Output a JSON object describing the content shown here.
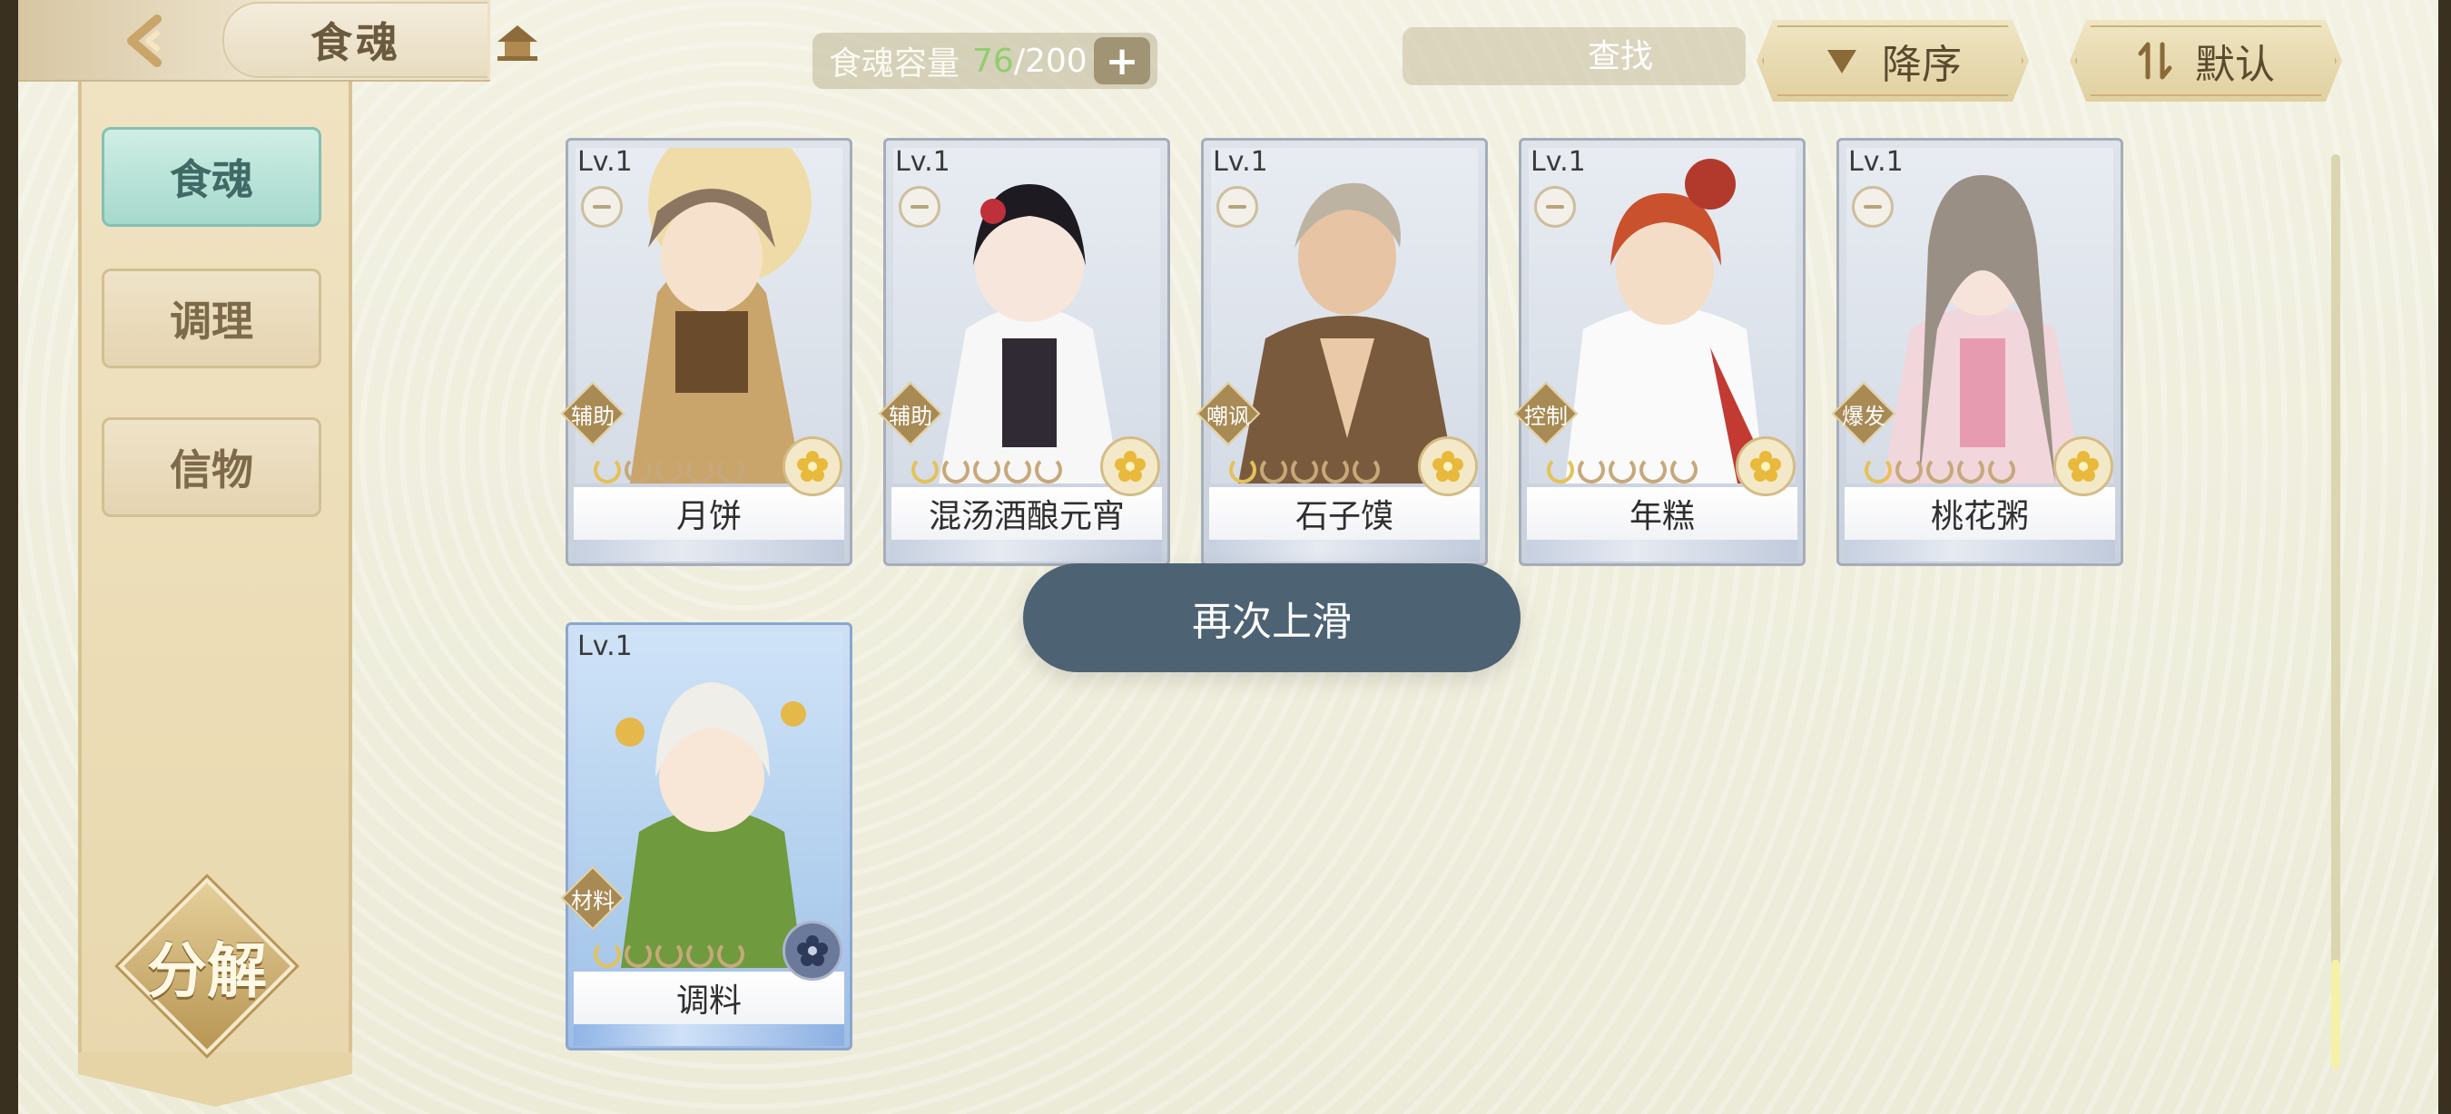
{
  "header": {
    "title": "食魂",
    "capacity_label": "食魂容量",
    "capacity_current": "76",
    "capacity_max": "/200",
    "plus_label": "+"
  },
  "search": {
    "placeholder": "查找",
    "value": ""
  },
  "sort": {
    "order_label": "降序",
    "mode_label": "默认"
  },
  "sidebar": {
    "tabs": [
      {
        "label": "食魂",
        "active": true
      },
      {
        "label": "调理",
        "active": false
      },
      {
        "label": "信物",
        "active": false
      }
    ],
    "decompose_label": "分解"
  },
  "cards": [
    {
      "level": "Lv.1",
      "role": "辅助",
      "name": "月饼",
      "stars": 5,
      "filled_stars": 1,
      "element": "flower-icon"
    },
    {
      "level": "Lv.1",
      "role": "辅助",
      "name": "混汤酒酿元宵",
      "stars": 5,
      "filled_stars": 1,
      "element": "flower-icon"
    },
    {
      "level": "Lv.1",
      "role": "嘲讽",
      "name": "石子馍",
      "stars": 5,
      "filled_stars": 1,
      "element": "flower-icon"
    },
    {
      "level": "Lv.1",
      "role": "控制",
      "name": "年糕",
      "stars": 5,
      "filled_stars": 1,
      "element": "flower-icon"
    },
    {
      "level": "Lv.1",
      "role": "爆发",
      "name": "桃花粥",
      "stars": 5,
      "filled_stars": 1,
      "element": "flower-icon"
    },
    {
      "level": "Lv.1",
      "role": "材料",
      "name": "调料",
      "stars": 5,
      "filled_stars": 1,
      "element": "dark-flower-icon"
    }
  ],
  "toast": {
    "text": "再次上滑"
  },
  "colors": {
    "active_tab": "#a6d9cd",
    "toast_bg": "#4d6273",
    "capacity_current": "#8fcf6f",
    "scroll_thumb": "#f3f2a8"
  }
}
